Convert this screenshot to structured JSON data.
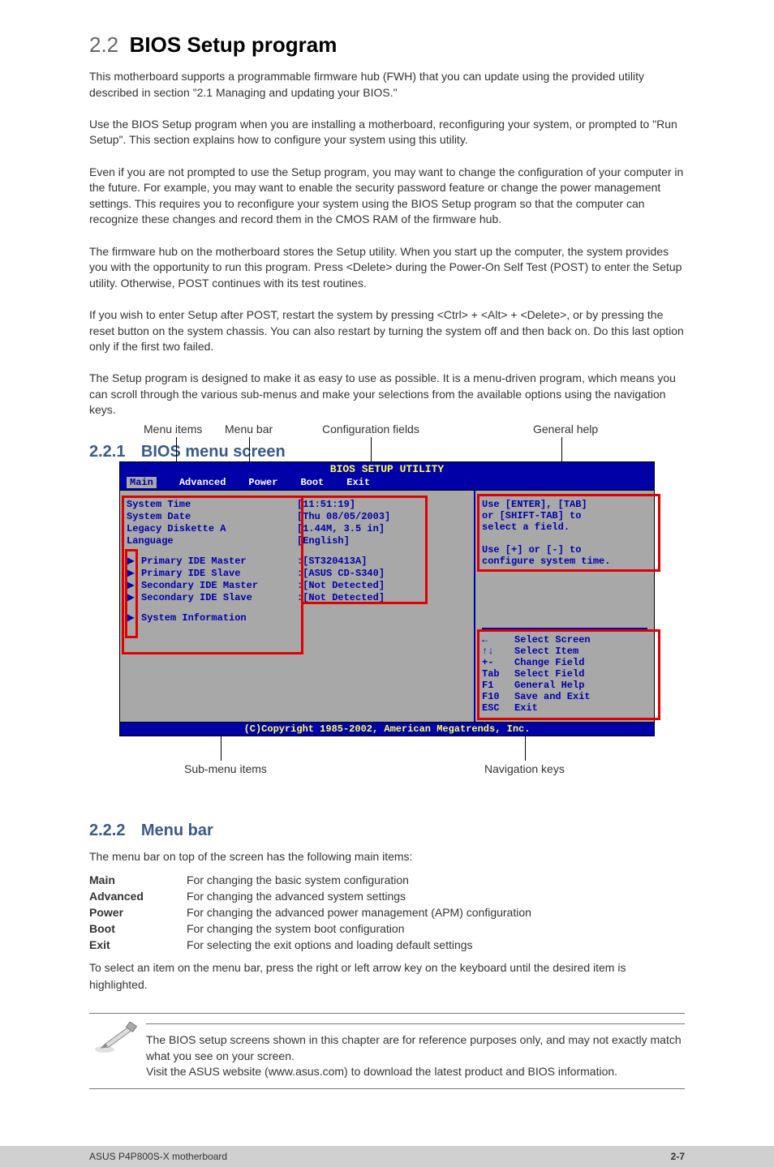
{
  "section": {
    "number": "2.2",
    "title": "BIOS Setup program"
  },
  "intro": "This motherboard supports a programmable firmware hub (FWH) that you can update using the provided utility described in section \"2.1 Managing and updating your BIOS.\"\n\nUse the BIOS Setup program when you are installing a motherboard, reconfiguring your system, or prompted to \"Run Setup\". This section explains how to configure your system using this utility.\n\nEven if you are not prompted to use the Setup program, you may want to change the configuration of your computer in the future. For example, you may want to enable the security password feature or change the power management settings. This requires you to reconfigure your system using the BIOS Setup program so that the computer can recognize these changes and record them in the CMOS RAM of the firmware hub.\n\nThe firmware hub on the motherboard stores the Setup utility. When you start up the computer, the system provides you with the opportunity to run this program. Press <Delete> during the Power-On Self Test (POST) to enter the Setup utility. Otherwise, POST continues with its test routines.\n\nIf you wish to enter Setup after POST, restart the system by pressing <Ctrl> + <Alt> + <Delete>, or by pressing the reset button on the system chassis. You can also restart by turning the system off and then back on. Do this last option only if the first two failed.\n\nThe Setup program is designed to make it as easy to use as possible. It is a menu-driven program, which means you can scroll through the various sub-menus and make your selections from the available options using the navigation keys.",
  "bios": {
    "title": "BIOS SETUP UTILITY",
    "menu": [
      "Main",
      "Advanced",
      "Power",
      "Boot",
      "Exit"
    ],
    "active_menu": "Main",
    "config_top": [
      {
        "label": "System Time",
        "value": "[11:51:19]"
      },
      {
        "label": "System Date",
        "value": "[Thu 08/05/2003]"
      },
      {
        "label": "Legacy Diskette A",
        "value": "[1.44M, 3.5 in]"
      },
      {
        "label": "Language",
        "value": "[English]"
      }
    ],
    "submenus": [
      {
        "label": "Primary IDE Master",
        "value": ":[ST320413A]"
      },
      {
        "label": "Primary IDE Slave",
        "value": ":[ASUS CD-S340]"
      },
      {
        "label": "Secondary IDE Master",
        "value": ":[Not Detected]"
      },
      {
        "label": "Secondary IDE Slave",
        "value": ":[Not Detected]"
      }
    ],
    "sysinfo": {
      "label": "System Information"
    },
    "help_field": "Use [ENTER], [TAB]\nor [SHIFT-TAB] to\nselect a field.\n\nUse [+] or [-] to\nconfigure system time.",
    "nav": [
      {
        "key": "←",
        "desc": "Select Screen"
      },
      {
        "key": "↑↓",
        "desc": "Select Item"
      },
      {
        "key": "+-",
        "desc": "Change Field"
      },
      {
        "key": "Tab",
        "desc": "Select Field"
      },
      {
        "key": "F1",
        "desc": "General Help"
      },
      {
        "key": "F10",
        "desc": "Save and Exit"
      },
      {
        "key": "ESC",
        "desc": "Exit"
      }
    ],
    "footer": "(C)Copyright 1985-2002, American Megatrends, Inc."
  },
  "callouts": {
    "menu_bar": "Menu bar",
    "config_fields": "Configuration fields",
    "general_help": "General help",
    "menu_items": "Menu items",
    "sub_menu": "Sub-menu items",
    "nav_keys": "Navigation keys"
  },
  "sub": {
    "number": "2.2.1",
    "title": "BIOS menu screen"
  },
  "sub2": {
    "number": "2.2.2",
    "title": "Menu bar",
    "intro": "The menu bar on top of the screen has the following main items:",
    "items": [
      {
        "name": "Main",
        "desc": "For changing the basic system configuration"
      },
      {
        "name": "Advanced",
        "desc": "For changing the advanced system settings"
      },
      {
        "name": "Power",
        "desc": "For changing the advanced power management (APM) configuration"
      },
      {
        "name": "Boot",
        "desc": "For changing the system boot configuration"
      },
      {
        "name": "Exit",
        "desc": "For selecting the exit options and loading default settings"
      }
    ],
    "tail": "To select an item on the menu bar, press the right or left arrow key on the keyboard until the desired item is highlighted."
  },
  "note": "The BIOS setup screens shown in this chapter are for reference purposes only, and may not exactly match what you see on your screen.\nVisit the ASUS website (www.asus.com) to download the latest product and BIOS information.",
  "footer": {
    "left": "ASUS P4P800S-X motherboard",
    "right": "2-7"
  }
}
